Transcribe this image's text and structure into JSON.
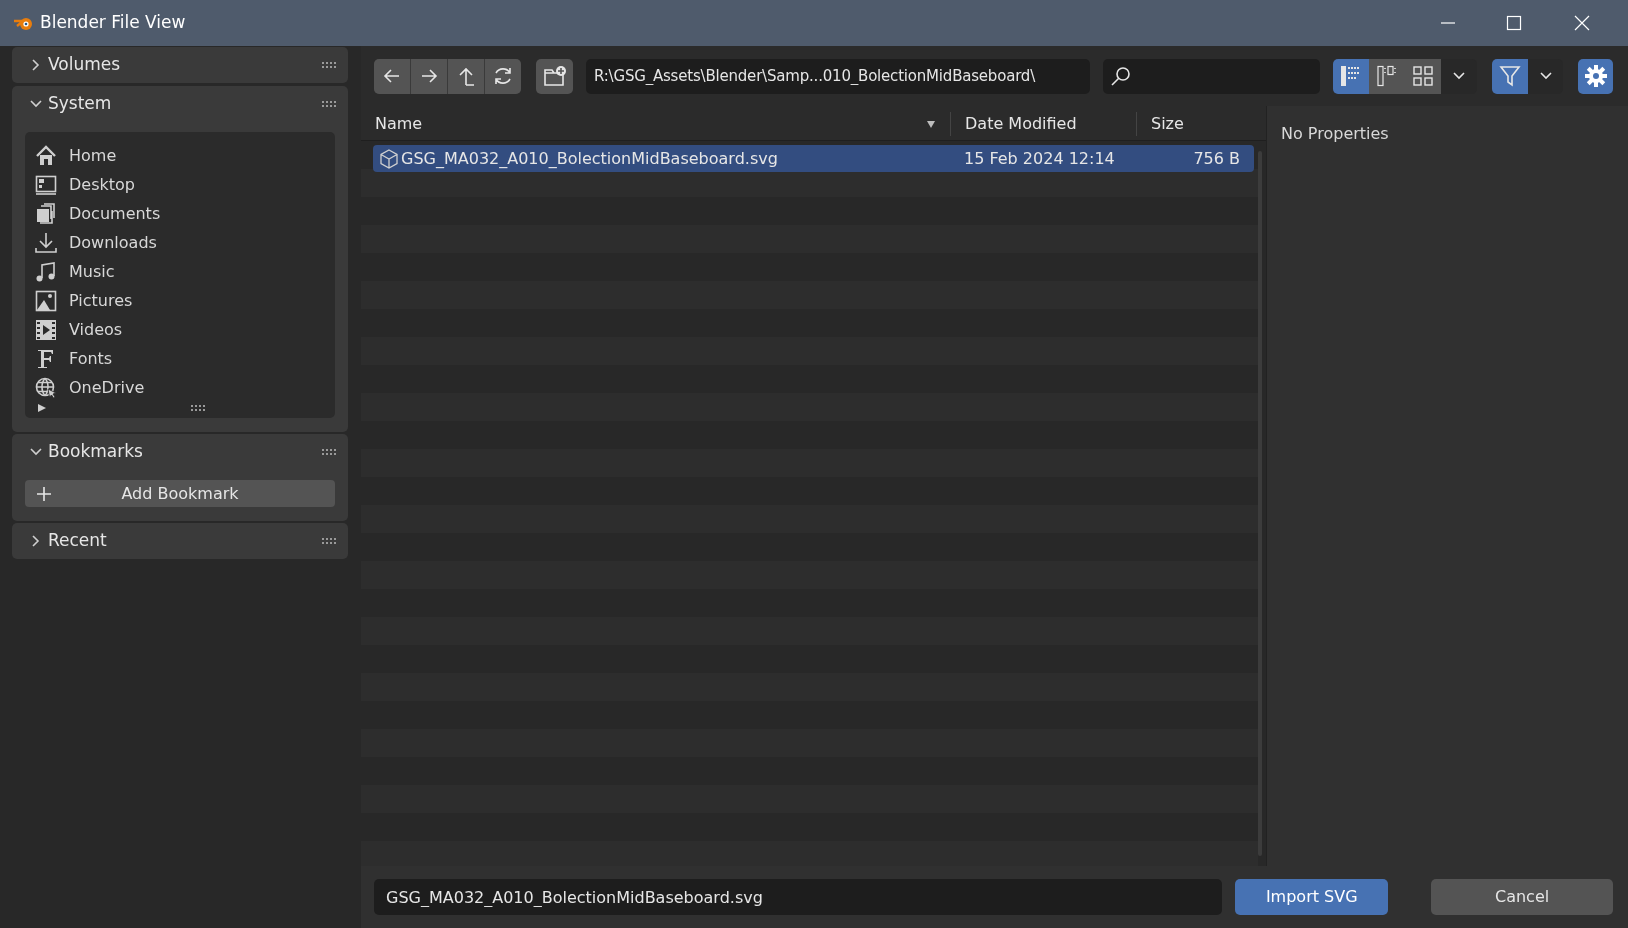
{
  "window": {
    "title": "Blender File View"
  },
  "sidebar": {
    "panels": [
      {
        "title": "Volumes",
        "expanded": false
      },
      {
        "kind": "list",
        "title": "System",
        "expanded": true,
        "items": [
          "Home",
          "Desktop",
          "Documents",
          "Downloads",
          "Music",
          "Pictures",
          "Videos",
          "Fonts",
          "OneDrive"
        ]
      },
      {
        "kind": "button",
        "title": "Bookmarks",
        "expanded": true,
        "button": "Add Bookmark"
      },
      {
        "title": "Recent",
        "expanded": false
      }
    ]
  },
  "toolbar": {
    "path": "R:\\GSG_Assets\\Blender\\Samp...010_BolectionMidBaseboard\\",
    "view_modes": [
      {
        "selected": true
      },
      {
        "selected": false
      },
      {
        "selected": false
      }
    ],
    "filter": {
      "on": true
    }
  },
  "table": {
    "columns": [
      {
        "label": "Name",
        "sorted": true
      },
      {
        "label": "Date Modified",
        "sorted": false
      },
      {
        "label": "Size",
        "sorted": false
      }
    ],
    "rows": [
      {
        "name": "GSG_MA032_A010_BolectionMidBaseboard.svg",
        "date": "15 Feb 2024 12:14",
        "size": "756 B",
        "selected": true
      }
    ]
  },
  "properties": {
    "text": "No Properties"
  },
  "footer": {
    "filename": "GSG_MA032_A010_BolectionMidBaseboard.svg",
    "buttons": [
      "Import SVG",
      "Cancel"
    ]
  }
}
